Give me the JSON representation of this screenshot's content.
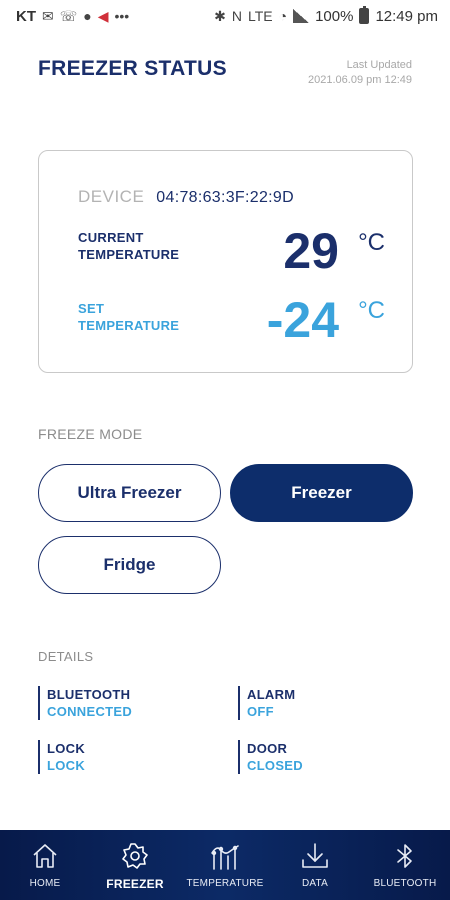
{
  "status_bar": {
    "carrier": "KT",
    "battery": "100%",
    "time": "12:49 pm",
    "network": "LTE"
  },
  "header": {
    "title": "FREEZER STATUS",
    "last_updated_label": "Last Updated",
    "last_updated_value": "2021.06.09 pm 12:49"
  },
  "device": {
    "label": "DEVICE",
    "id": "04:78:63:3F:22:9D",
    "current_temp_label_1": "CURRENT",
    "current_temp_label_2": "TEMPERATURE",
    "current_temp_value": "29",
    "set_temp_label_1": "SET",
    "set_temp_label_2": "TEMPERATURE",
    "set_temp_value": "-24",
    "unit": "°C"
  },
  "freeze_mode": {
    "label": "FREEZE MODE",
    "options": [
      "Ultra Freezer",
      "Freezer",
      "Fridge"
    ],
    "selected": "Freezer"
  },
  "details": {
    "label": "DETAILS",
    "items": [
      {
        "title": "BLUETOOTH",
        "value": "CONNECTED"
      },
      {
        "title": "ALARM",
        "value": "OFF"
      },
      {
        "title": "LOCK",
        "value": "LOCK"
      },
      {
        "title": "DOOR",
        "value": "CLOSED"
      }
    ]
  },
  "bottom_nav": {
    "items": [
      {
        "label": "HOME",
        "icon": "home-icon"
      },
      {
        "label": "FREEZER",
        "icon": "snowflake-gear-icon"
      },
      {
        "label": "TEMPERATURE",
        "icon": "thermometer-chart-icon"
      },
      {
        "label": "DATA",
        "icon": "download-icon"
      },
      {
        "label": "BLUETOOTH",
        "icon": "bluetooth-icon"
      }
    ],
    "active": "FREEZER"
  },
  "colors": {
    "navy": "#1b2f6b",
    "accent_blue": "#3aa3dc",
    "nav_background": "#0c2a66",
    "muted_gray": "#a8a8a8"
  }
}
